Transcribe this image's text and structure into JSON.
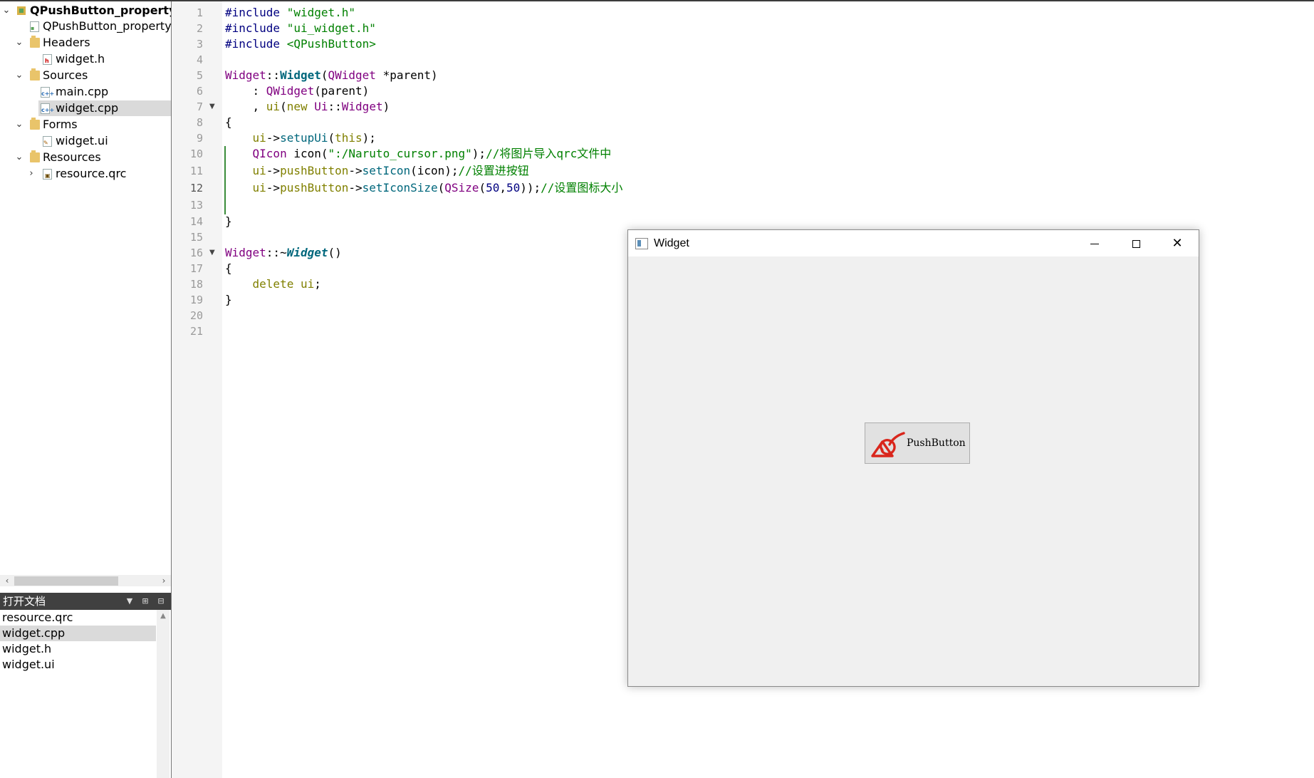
{
  "project_tree": {
    "items": [
      {
        "label": "QPushButton_property_icon",
        "arrow": "⌄",
        "icon": "project",
        "bold": true
      },
      {
        "label": "QPushButton_property_icon.pro",
        "arrow": "",
        "icon": "pro-file"
      },
      {
        "label": "Headers",
        "arrow": "⌄",
        "icon": "folder"
      },
      {
        "label": "widget.h",
        "arrow": "",
        "icon": "h-file"
      },
      {
        "label": "Sources",
        "arrow": "⌄",
        "icon": "folder"
      },
      {
        "label": "main.cpp",
        "arrow": "",
        "icon": "cpp-file"
      },
      {
        "label": "widget.cpp",
        "arrow": "",
        "icon": "cpp-file",
        "selected": true
      },
      {
        "label": "Forms",
        "arrow": "⌄",
        "icon": "folder"
      },
      {
        "label": "widget.ui",
        "arrow": "",
        "icon": "ui-file"
      },
      {
        "label": "Resources",
        "arrow": "⌄",
        "icon": "folder"
      },
      {
        "label": "resource.qrc",
        "arrow": "›",
        "icon": "qrc-file"
      }
    ]
  },
  "open_documents": {
    "title": "打开文档",
    "items": [
      "resource.qrc",
      "widget.cpp",
      "widget.h",
      "widget.ui"
    ],
    "selected": "widget.cpp"
  },
  "editor": {
    "line_numbers": [
      "1",
      "2",
      "3",
      "4",
      "5",
      "6",
      "7",
      "8",
      "9",
      "10",
      "11",
      "12",
      "13",
      "14",
      "15",
      "16",
      "17",
      "18",
      "19",
      "20",
      "21"
    ],
    "current_line": "12",
    "l1": {
      "pp": "#include",
      "str": " \"widget.h\""
    },
    "l2": {
      "pp": "#include",
      "str": " \"ui_widget.h\""
    },
    "l3": {
      "pp": "#include",
      "str": " <QPushButton>"
    },
    "l5": {
      "cls": "Widget",
      "sep": "::",
      "fn": "Widget",
      "open": "(",
      "type": "QWidget",
      "rest": " *parent",
      "close": ")"
    },
    "l6": {
      "pre": "    : ",
      "cls": "QWidget",
      "rest": "(parent)"
    },
    "l7": {
      "pre": "    , ",
      "kw1": "ui",
      "p1": "(",
      "kw2": "new",
      "sp": " ",
      "cls": "Ui",
      "sep": "::",
      "cls2": "Widget",
      "close": ")"
    },
    "l8": "{",
    "l9": {
      "pre": "    ",
      "obj": "ui",
      "arrow": "->",
      "fn": "setupUi",
      "open": "(",
      "kw": "this",
      "close": ");"
    },
    "l10": {
      "pre": "    ",
      "cls": "QIcon",
      "mid": " icon(",
      "str": "\":/Naruto_cursor.png\"",
      "close": ");",
      "cm": "//将图片导入qrc文件中"
    },
    "l11": {
      "pre": "    ",
      "obj": "ui",
      "a1": "->",
      "m1": "pushButton",
      "a2": "->",
      "fn": "setIcon",
      "rest": "(icon);",
      "cm": "//设置进按钮"
    },
    "l12": {
      "pre": "    ",
      "obj": "ui",
      "a1": "->",
      "m1": "pushButton",
      "a2": "->",
      "fn": "setIconSize",
      "open": "(",
      "cls": "QSize",
      "p": "(",
      "n1": "50",
      "comma": ",",
      "n2": "50",
      "close": "));",
      "cm": "//设置图标大小"
    },
    "l14": "}",
    "l16": {
      "cls": "Widget",
      "sep": "::~",
      "fn": "Widget",
      "rest": "()"
    },
    "l17": "{",
    "l18": {
      "pre": "    ",
      "kw": "delete",
      "rest": " ",
      "obj": "ui",
      "end": ";"
    },
    "l19": "}"
  },
  "widget_window": {
    "title": "Widget",
    "button_label": "PushButton",
    "icon_color": "#d9261c"
  }
}
